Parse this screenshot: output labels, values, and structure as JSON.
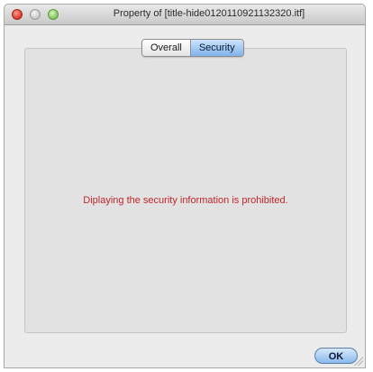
{
  "window": {
    "title": "Property of [title-hide0120110921132320.itf]"
  },
  "tabs": [
    {
      "label": "Overall",
      "selected": false
    },
    {
      "label": "Security",
      "selected": true
    }
  ],
  "panel": {
    "message": "Diplaying the security information is prohibited."
  },
  "footer": {
    "ok_label": "OK"
  },
  "colors": {
    "message_text": "#c0262a",
    "selected_tab": "#7fb2ec",
    "ok_button": "#8ab8ec",
    "close_button": "#d5362b",
    "zoom_button": "#7fc25a"
  }
}
